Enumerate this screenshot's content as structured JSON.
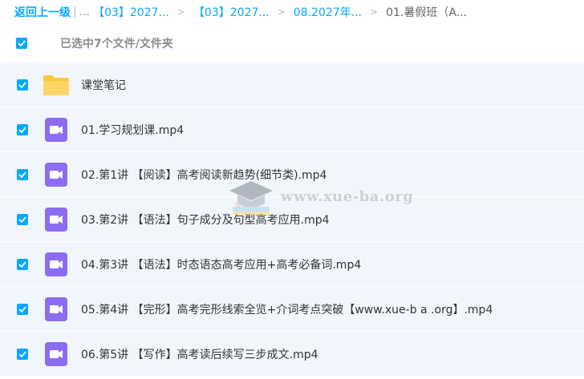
{
  "breadcrumb": {
    "back_label": "返回上一级",
    "divider": "|",
    "ellipsis": "...",
    "segments": [
      "【03】2027...",
      "【03】2027...",
      "08.2027年..."
    ],
    "separator": ">",
    "current": "01.暑假班（A..."
  },
  "selection": {
    "text": "已选中7个文件/文件夹"
  },
  "files": [
    {
      "name": "课堂笔记",
      "type": "folder"
    },
    {
      "name": "01.学习规划课.mp4",
      "type": "video"
    },
    {
      "name": "02.第1讲 【阅读】高考阅读新趋势(细节类).mp4",
      "type": "video"
    },
    {
      "name": "03.第2讲 【语法】句子成分及句型高考应用.mp4",
      "type": "video"
    },
    {
      "name": "04.第3讲 【语法】时态语态高考应用+高考必备词.mp4",
      "type": "video"
    },
    {
      "name": "05.第4讲 【完形】高考完形线索全览+介词考点突破【www.xue-b a .org】.mp4",
      "type": "video"
    },
    {
      "name": "06.第5讲 【写作】高考读后续写三步成文.mp4",
      "type": "video"
    }
  ],
  "watermark": {
    "text": "www.xue-ba.org"
  },
  "colors": {
    "accent": "#06a7ff",
    "row_background": "#f1f6fd",
    "folder": "#ffc83d",
    "video": "#8c6cf2"
  },
  "icons": {
    "checkbox": "checkbox-checked-icon",
    "folder": "folder-icon",
    "video": "video-file-icon"
  }
}
